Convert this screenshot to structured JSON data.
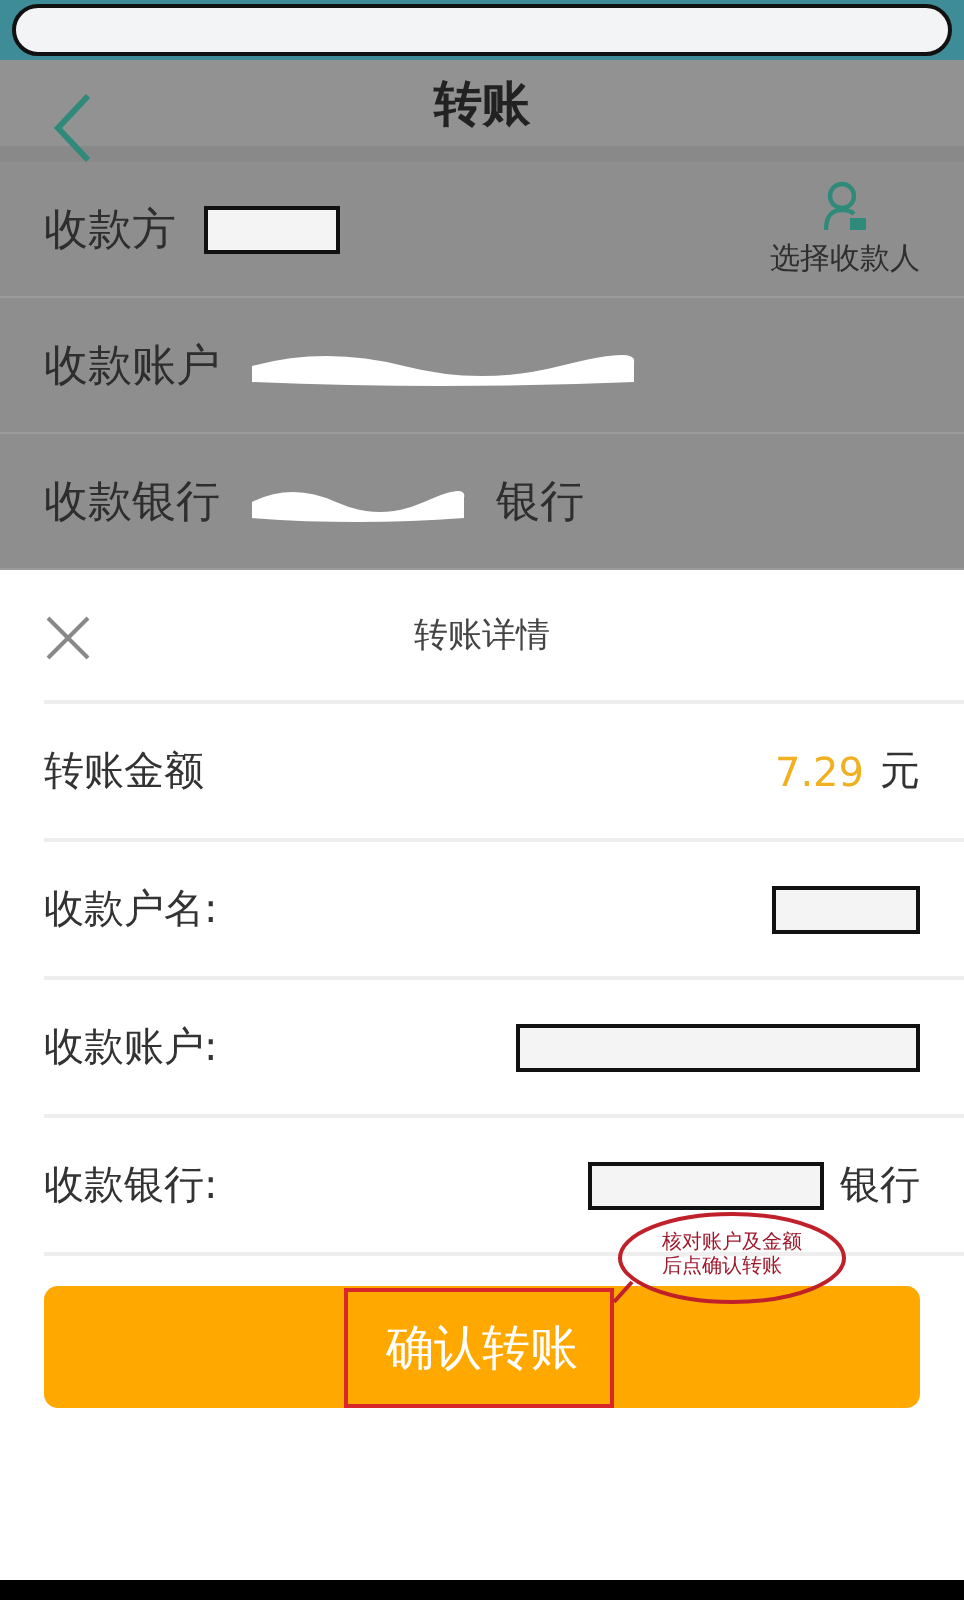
{
  "header": {
    "title": "转账"
  },
  "form": {
    "picker_label": "选择收款人",
    "rows": [
      {
        "label": "收款方",
        "kind": "boxed"
      },
      {
        "label": "收款账户",
        "kind": "scribble"
      },
      {
        "label": "收款银行",
        "kind": "scribble",
        "suffix": "银行"
      }
    ]
  },
  "sheet": {
    "title": "转账详情",
    "rows": [
      {
        "label": "转账金额",
        "kind": "amount",
        "amount": "7.29",
        "unit": "元"
      },
      {
        "label": "收款户名:",
        "kind": "boxed"
      },
      {
        "label": "收款账户:",
        "kind": "wide"
      },
      {
        "label": "收款银行:",
        "kind": "wide",
        "suffix": "银行"
      }
    ],
    "confirm": "确认转账",
    "annotation": "核对账户及金额后点确认转账"
  }
}
